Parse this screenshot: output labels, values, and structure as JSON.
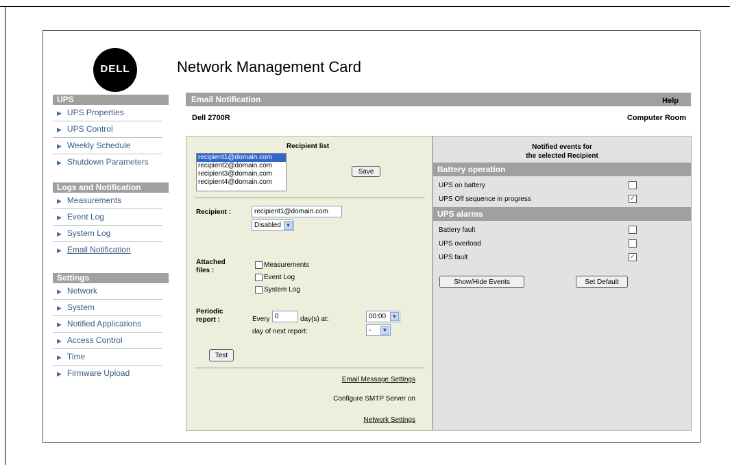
{
  "app": {
    "title": "Network Management Card",
    "logo": "DELL"
  },
  "sidebar": {
    "sections": [
      {
        "label": "UPS",
        "items": [
          "UPS Properties",
          "UPS Control",
          "Weekly Schedule",
          "Shutdown Parameters"
        ]
      },
      {
        "label": "Logs and Notification",
        "items": [
          "Measurements",
          "Event Log",
          "System Log",
          "Email Notification"
        ]
      },
      {
        "label": "Settings",
        "items": [
          "Network",
          "System",
          "Notified Applications",
          "Access Control",
          "Time",
          "Firmware Upload"
        ]
      }
    ]
  },
  "header": {
    "title": "Email Notification",
    "help": "Help",
    "model": "Dell 2700R",
    "location": "Computer Room"
  },
  "left": {
    "recipient_list_title": "Recipient list",
    "recipients": [
      "recipient1@domain.com",
      "recipient2@domain.com",
      "recipient3@domain.com",
      "recipient4@domain.com"
    ],
    "save": "Save",
    "recipient_label": "Recipient :",
    "recipient_value": "recipient1@domain.com",
    "status_value": "Disabled",
    "attached_label_1": "Attached",
    "attached_label_2": "files :",
    "attached": [
      "Measurements",
      "Event Log",
      "System Log"
    ],
    "periodic_label_1": "Periodic",
    "periodic_label_2": "report :",
    "every": "Every",
    "every_value": "0",
    "days_at": "day(s) at:",
    "time_value": "00:00",
    "next_report": "day of next report:",
    "next_value": "-",
    "test": "Test",
    "email_msg_link": "Email Message Settings",
    "smtp_text": "Configure SMTP Server on",
    "network_link": "Network Settings"
  },
  "right": {
    "title_1": "Notified events for",
    "title_2": "the selected Recipient",
    "groups": [
      {
        "label": "Battery operation",
        "events": [
          {
            "name": "UPS on battery",
            "checked": false
          },
          {
            "name": "UPS Off sequence in progress",
            "checked": true
          }
        ]
      },
      {
        "label": "UPS alarms",
        "events": [
          {
            "name": "Battery fault",
            "checked": false
          },
          {
            "name": "UPS overload",
            "checked": false
          },
          {
            "name": "UPS fault",
            "checked": true
          }
        ]
      }
    ],
    "show_hide": "Show/Hide Events",
    "set_default": "Set Default"
  }
}
